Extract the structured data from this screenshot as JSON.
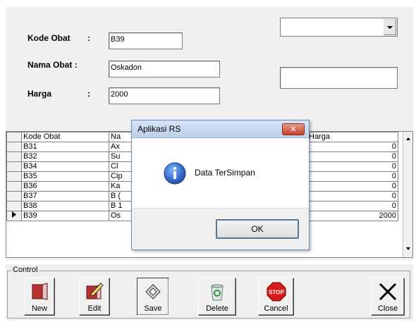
{
  "form": {
    "kode_label": "Kode Obat",
    "nama_label": "Nama Obat :",
    "harga_label": "Harga",
    "colon": ":",
    "kode_value": "B39",
    "nama_value": "Oskadon",
    "harga_value": "2000",
    "combo_value": "",
    "side_text_value": ""
  },
  "grid": {
    "headers": [
      "Kode Obat",
      "Na",
      "Harga"
    ],
    "rows": [
      {
        "kode": "B31",
        "nama": "Ax",
        "harga": "0"
      },
      {
        "kode": "B32",
        "nama": "Su",
        "harga": "0"
      },
      {
        "kode": "B34",
        "nama": "Cl",
        "harga": "0"
      },
      {
        "kode": "B35",
        "nama": "Cip",
        "harga": "0"
      },
      {
        "kode": "B36",
        "nama": "Ka",
        "harga": "0"
      },
      {
        "kode": "B37",
        "nama": "B (",
        "harga": "0"
      },
      {
        "kode": "B38",
        "nama": "B 1",
        "harga": "0"
      },
      {
        "kode": "B39",
        "nama": "Os",
        "harga": "2000",
        "selected": true
      }
    ]
  },
  "control": {
    "legend": "Control",
    "buttons": [
      {
        "id": "new",
        "label": "New",
        "icon": "new-door-icon"
      },
      {
        "id": "edit",
        "label": "Edit",
        "icon": "edit-pencil-icon"
      },
      {
        "id": "save",
        "label": "Save",
        "icon": "save-disk-icon"
      },
      {
        "id": "delete",
        "label": "Delete",
        "icon": "recycle-bin-icon"
      },
      {
        "id": "cancel",
        "label": "Cancel",
        "icon": "stop-sign-icon"
      },
      {
        "id": "close",
        "label": "Close",
        "icon": "close-x-icon"
      }
    ],
    "stop_text": "STOP"
  },
  "dialog": {
    "title": "Aplikasi RS",
    "message": "Data TerSimpan",
    "ok_label": "OK",
    "close_glyph": "✕",
    "icon": "info-icon"
  }
}
